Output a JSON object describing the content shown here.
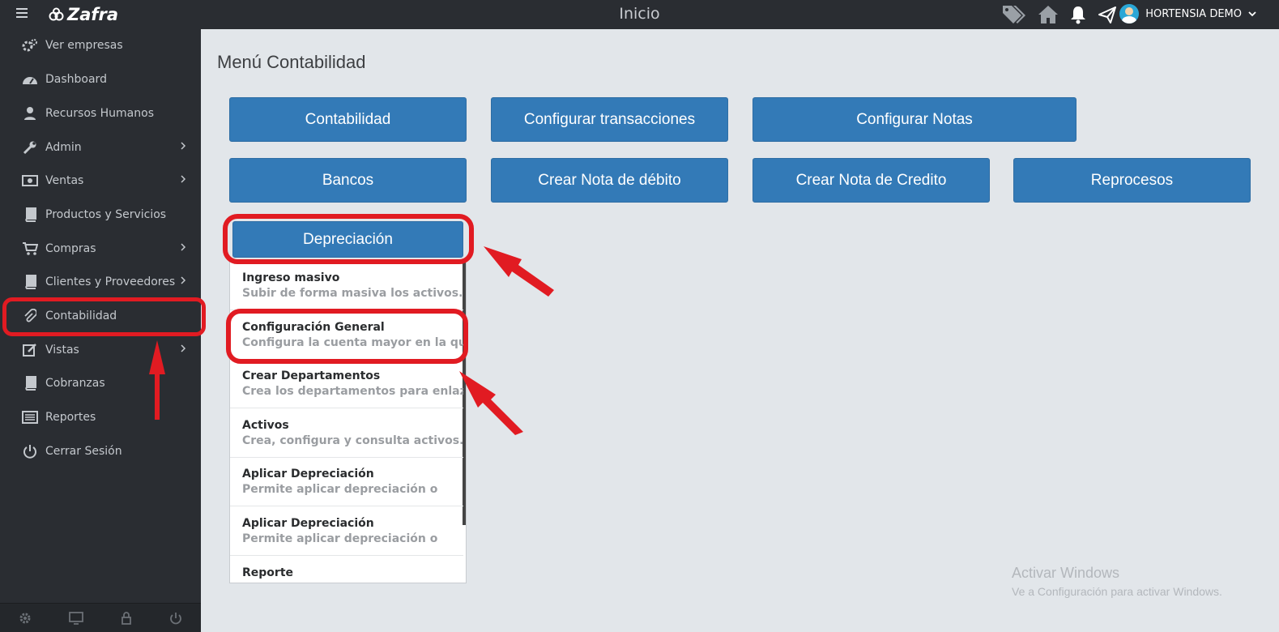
{
  "topbar": {
    "brand": "Zafra",
    "page_title": "Inicio",
    "user_name": "HORTENSIA DEMO",
    "icons": [
      "tags-icon",
      "home-icon",
      "bell-icon",
      "paper-plane-icon"
    ]
  },
  "sidebar": {
    "items": [
      {
        "label": "Ver empresas",
        "icon": "gears-icon",
        "submenu": false
      },
      {
        "label": "Dashboard",
        "icon": "dashboard-icon",
        "submenu": false
      },
      {
        "label": "Recursos Humanos",
        "icon": "user-icon",
        "submenu": false
      },
      {
        "label": "Admin",
        "icon": "wrench-icon",
        "submenu": true
      },
      {
        "label": "Ventas",
        "icon": "money-icon",
        "submenu": true
      },
      {
        "label": "Productos y Servicios",
        "icon": "book-icon",
        "submenu": false
      },
      {
        "label": "Compras",
        "icon": "cart-icon",
        "submenu": true
      },
      {
        "label": "Clientes y Proveedores",
        "icon": "book-icon",
        "submenu": true
      },
      {
        "label": "Contabilidad",
        "icon": "paperclip-icon",
        "submenu": false
      },
      {
        "label": "Vistas",
        "icon": "edit-icon",
        "submenu": true
      },
      {
        "label": "Cobranzas",
        "icon": "book-icon",
        "submenu": false
      },
      {
        "label": "Reportes",
        "icon": "list-icon",
        "submenu": false
      },
      {
        "label": "Cerrar Sesión",
        "icon": "power-icon",
        "submenu": false
      }
    ],
    "footer_icons": [
      "settings-icon",
      "monitor-icon",
      "lock-icon",
      "power-icon"
    ]
  },
  "main": {
    "title": "Menú Contabilidad",
    "buttons": [
      "Contabilidad",
      "Configurar transacciones",
      "Configurar Notas",
      "Bancos",
      "Crear Nota de débito",
      "Crear Nota de Credito",
      "Reprocesos",
      "Depreciación"
    ],
    "dropdown": [
      {
        "title": "Ingreso masivo",
        "desc": "Subir de forma masiva los activos."
      },
      {
        "title": "Configuración General",
        "desc": "Configura la cuenta mayor en la que"
      },
      {
        "title": "Crear Departamentos",
        "desc": "Crea los departamentos para enlazar"
      },
      {
        "title": "Activos",
        "desc": "Crea, configura y consulta activos."
      },
      {
        "title": "Aplicar Depreciación",
        "desc": "Permite aplicar depreciación o"
      },
      {
        "title": "Aplicar Depreciación",
        "desc": "Permite aplicar depreciación o"
      },
      {
        "title": "Reporte",
        "desc": ""
      }
    ]
  },
  "watermark": {
    "line1": "Activar Windows",
    "line2": "Ve a Configuración para activar Windows."
  },
  "colors": {
    "topbar": "#2a2d32",
    "button": "#337ab7",
    "annotation": "#e11b22",
    "background": "#e2e6ea"
  }
}
